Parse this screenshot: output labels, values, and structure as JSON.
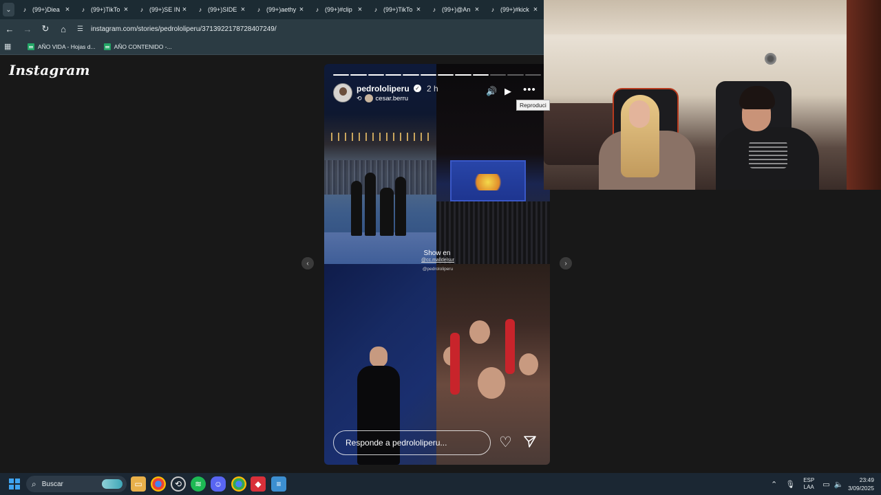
{
  "browser": {
    "tabs": [
      {
        "label": "(99+)Diea"
      },
      {
        "label": "(99+)TikTo"
      },
      {
        "label": "(99+)SE IN"
      },
      {
        "label": "(99+)SIDE"
      },
      {
        "label": "(99+)aethy"
      },
      {
        "label": "(99+)#clip"
      },
      {
        "label": "(99+)TikTo"
      },
      {
        "label": "(99+)@An"
      },
      {
        "label": "(99+)#kick"
      }
    ],
    "url": "instagram.com/stories/pedrololiperu/3713922178728407249/",
    "bookmarks": [
      {
        "label": "AÑO VIDA - Hojas d..."
      },
      {
        "label": "AÑO CONTENIDO -..."
      }
    ]
  },
  "page": {
    "logo": "Instagram",
    "story": {
      "progress": {
        "total": 12,
        "done": 9
      },
      "username": "pedrololiperu",
      "time": "2 h",
      "reposted_from": "cesar.berru",
      "tooltip": "Reproduci",
      "overlay_title": "Show en",
      "overlay_mention": "@cc.malldelsur",
      "overlay_credit": "@pedrololiperu",
      "reply_placeholder": "Responde a pedrololiperu..."
    }
  },
  "taskbar": {
    "search_label": "Buscar",
    "lang_top": "ESP",
    "lang_bottom": "LAA",
    "time": "23:49",
    "date": "3/09/2025"
  }
}
